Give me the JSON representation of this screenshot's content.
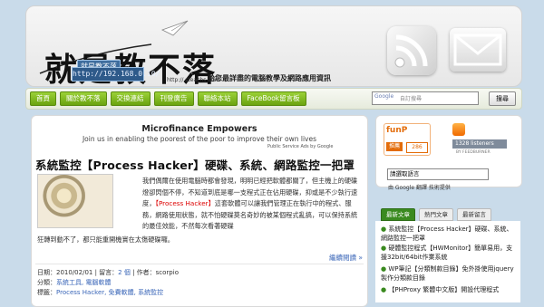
{
  "header": {
    "logo_text": "就是教不落",
    "logo_tag": "就是教不落",
    "logo_ip": "http://192.168.0.10/",
    "logo_url": "http:// steachs.com",
    "tagline": "給您最詳盡的電腦教學及網路應用資訊"
  },
  "nav": {
    "items": [
      "首頁",
      "關於教不落",
      "交換連結",
      "刊登廣告",
      "聯絡本站",
      "FaceBook留言板"
    ],
    "search_brand": "Google",
    "search_placeholder": "自訂搜尋",
    "search_button": "搜尋"
  },
  "ad": {
    "title": "Microfinance Empowers",
    "subtitle": "Join us in enabling the poorest of the poor to improve their own lives",
    "credit": "Public Service Ads by Google"
  },
  "post": {
    "title": "系統監控【Process Hacker】硬碟、系統、網路監控一把罩",
    "excerpt_1": "我們偶爾在使用電腦時都會發現，明明已經把軟體都關了，但主機上的硬碟燈卻閃個不停，不知道到底是哪一支程式正在佔用硬碟，",
    "excerpt_2": "抑或是不少執行速度，",
    "highlight": "【Process Hacker】",
    "excerpt_3": "這套軟體可以讓我們管理正在執行中的程式、服務，網路使用狀態，就不怕硬碟莫名奇妙的被某個程式亂搞，可以保持系統的最佳效能，不然每次看著硬碟",
    "excerpt_cont": "狂轉到動不了，都只能重開機實在太傷硬碟囉。",
    "read_more": "繼續閱讀 »",
    "meta_date_label": "日期：2010/02/01 | 留言：",
    "meta_comments": "2 個",
    "meta_author": " | 作者：scorpio",
    "meta_category_label": "分類：",
    "meta_categories": "系統工具, 電腦軟體",
    "meta_tags_label": "標籤：",
    "meta_tags": "Process Hacker, 免費軟體, 系統監控"
  },
  "sidebar": {
    "funp_logo": "funP",
    "funp_label": "推薦",
    "funp_count": "286",
    "feed_count": "1328 listeners",
    "feed_by": "BY FEEDBURNER",
    "lang_select": "請選取語言",
    "lang_credit": "由 Google 翻譯 技術提供",
    "tabs": [
      "最新文章",
      "熱門文章",
      "最新留言"
    ],
    "recent": [
      "系統監控【Process Hacker】硬碟、系統、網路監控一把罩",
      "硬體監控程式【HWMonitor】簡單易用，支援32bit/64bit作業系統",
      "WP筆記【分類制款目錄】免外掛使用jquery製作分類款目錄",
      "【PHProxy 繁體中文版】開設代理程式"
    ]
  }
}
